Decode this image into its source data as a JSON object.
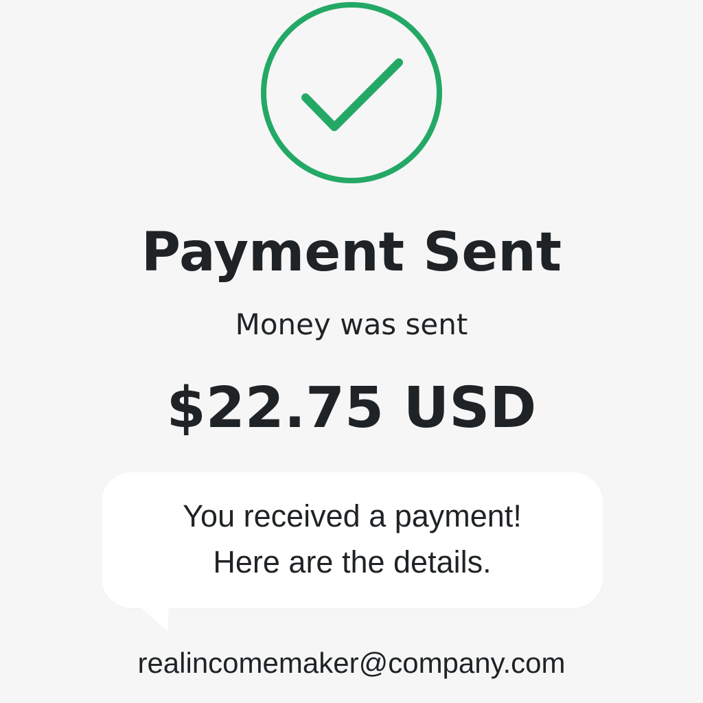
{
  "status_icon": "check-circle-icon",
  "accent_color": "#24a866",
  "background_color": "#f6f6f6",
  "text_color": "#1f2326",
  "header": {
    "title": "Payment Sent",
    "subtitle": "Money was sent"
  },
  "payment": {
    "amount": "$22.75 USD"
  },
  "message": {
    "line1": "You received a payment!",
    "line2": "Here are the details."
  },
  "recipient": {
    "email": "realincomemaker@company.com"
  }
}
